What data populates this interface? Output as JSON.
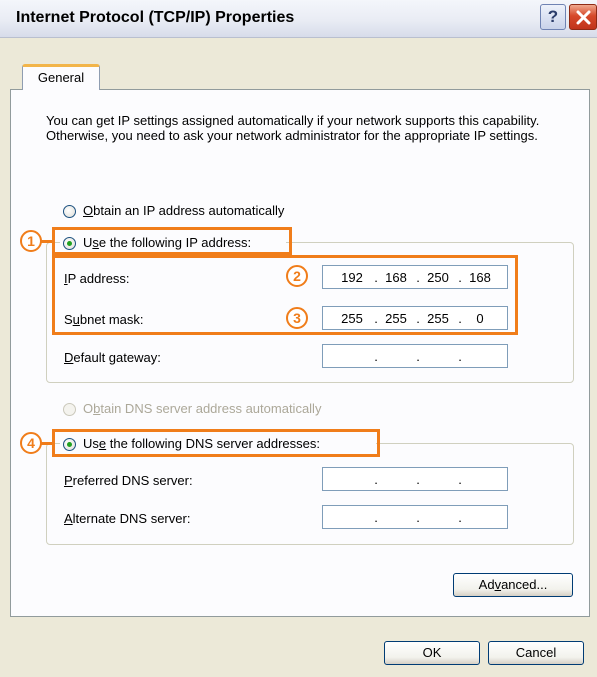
{
  "window": {
    "title": "Internet Protocol (TCP/IP) Properties",
    "help_button": "?",
    "close_icon": "close-icon"
  },
  "tabs": [
    {
      "label": "General",
      "active": true
    }
  ],
  "description": "You can get IP settings assigned automatically if your network supports this capability. Otherwise, you need to ask your network administrator for the appropriate IP settings.",
  "ip_section": {
    "auto_option": {
      "pre": "",
      "mnemonic": "O",
      "post": "btain an IP address automatically",
      "selected": false
    },
    "manual_option": {
      "pre": "U",
      "mnemonic": "s",
      "post": "e the following IP address:",
      "selected": true
    },
    "fields": [
      {
        "pre": "",
        "mnemonic": "I",
        "post": "P address:",
        "value": [
          "192",
          "168",
          "250",
          "168"
        ]
      },
      {
        "pre": "S",
        "mnemonic": "u",
        "post": "bnet mask:",
        "value": [
          "255",
          "255",
          "255",
          "0"
        ]
      },
      {
        "pre": "",
        "mnemonic": "D",
        "post": "efault gateway:",
        "value": [
          "",
          "",
          "",
          ""
        ]
      }
    ]
  },
  "dns_section": {
    "auto_option": {
      "pre": "O",
      "mnemonic": "b",
      "post": "tain DNS server address automatically",
      "selected": false,
      "disabled": true
    },
    "manual_option": {
      "pre": "Us",
      "mnemonic": "e",
      "post": " the following DNS server addresses:",
      "selected": true
    },
    "fields": [
      {
        "pre": "",
        "mnemonic": "P",
        "post": "referred DNS server:",
        "value": [
          "",
          "",
          "",
          ""
        ]
      },
      {
        "pre": "",
        "mnemonic": "A",
        "post": "lternate DNS server:",
        "value": [
          "",
          "",
          "",
          ""
        ]
      }
    ]
  },
  "buttons": {
    "advanced": {
      "pre": "Ad",
      "mnemonic": "v",
      "post": "anced..."
    },
    "ok": "OK",
    "cancel": "Cancel"
  },
  "annotations": {
    "color": "#f07d1a",
    "step1": "1",
    "step2": "2",
    "step3": "3",
    "step4": "4"
  }
}
